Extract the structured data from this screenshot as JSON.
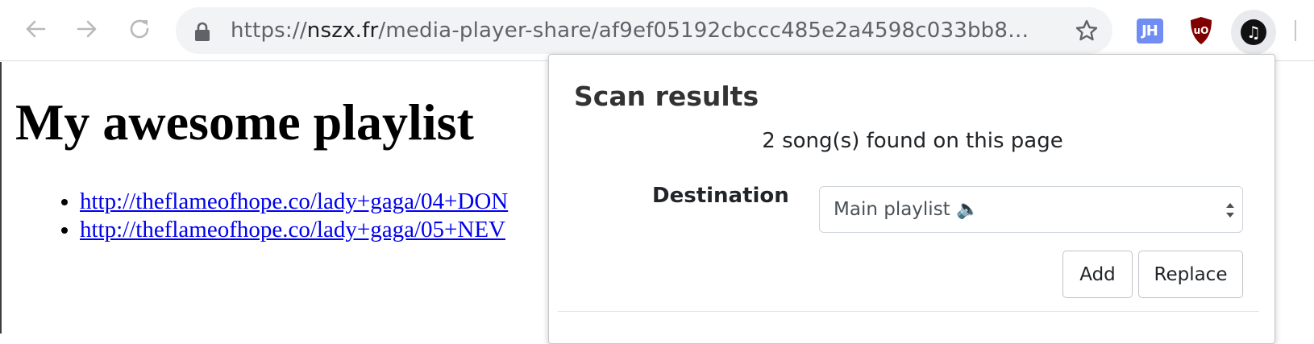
{
  "browser": {
    "url_scheme": "https://",
    "url_host": "nszx.fr",
    "url_path": "/media-player-share/af9ef05192cbccc485e2a4598c033bb8…",
    "extensions": {
      "jh_label": "JH",
      "ublock_label": "uO"
    }
  },
  "page": {
    "heading": "My awesome playlist",
    "links": [
      "http://theflameofhope.co/lady+gaga/04+DON",
      "http://theflameofhope.co/lady+gaga/05+NEV"
    ]
  },
  "popup": {
    "title": "Scan results",
    "summary": "2 song(s) found on this page",
    "destination_label": "Destination",
    "destination_value": "Main playlist 🔈",
    "add_label": "Add",
    "replace_label": "Replace"
  },
  "icons": {
    "back": "back-arrow-icon",
    "forward": "forward-arrow-icon",
    "reload": "reload-icon",
    "lock": "lock-icon",
    "bookmark": "star-icon",
    "music": "music-note-icon"
  },
  "colors": {
    "link": "#0000ee",
    "jh_badge": "#6f8df2",
    "ublock_shield": "#800000",
    "omnibox": "#f1f3f4"
  }
}
